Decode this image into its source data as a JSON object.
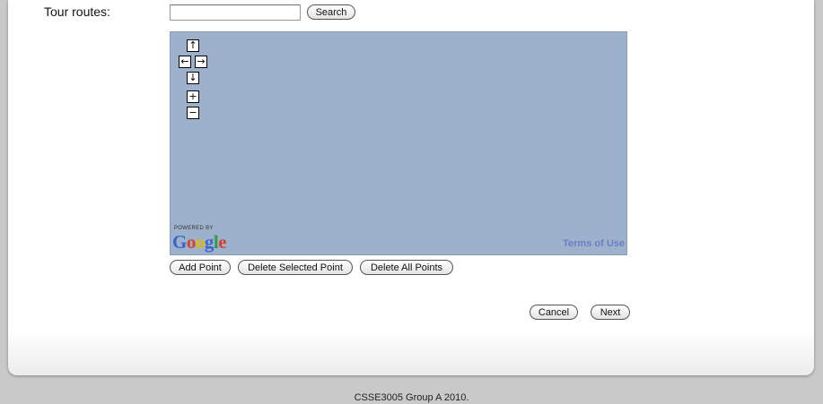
{
  "form": {
    "label": "Tour routes:",
    "search_value": "",
    "search_placeholder": "",
    "search_button": "Search"
  },
  "map": {
    "controls": {
      "pan_up": "↑",
      "pan_left": "←",
      "pan_right": "→",
      "pan_down": "↓",
      "zoom_in": "+",
      "zoom_out": "−"
    },
    "powered_by": "POWERED BY",
    "logo": "Google",
    "terms": "Terms of Use",
    "background": "#9eb1cc"
  },
  "point_actions": {
    "add": "Add Point",
    "delete_selected": "Delete Selected Point",
    "delete_all": "Delete All Points"
  },
  "nav": {
    "cancel": "Cancel",
    "next": "Next"
  },
  "footer": "CSSE3005 Group A 2010."
}
